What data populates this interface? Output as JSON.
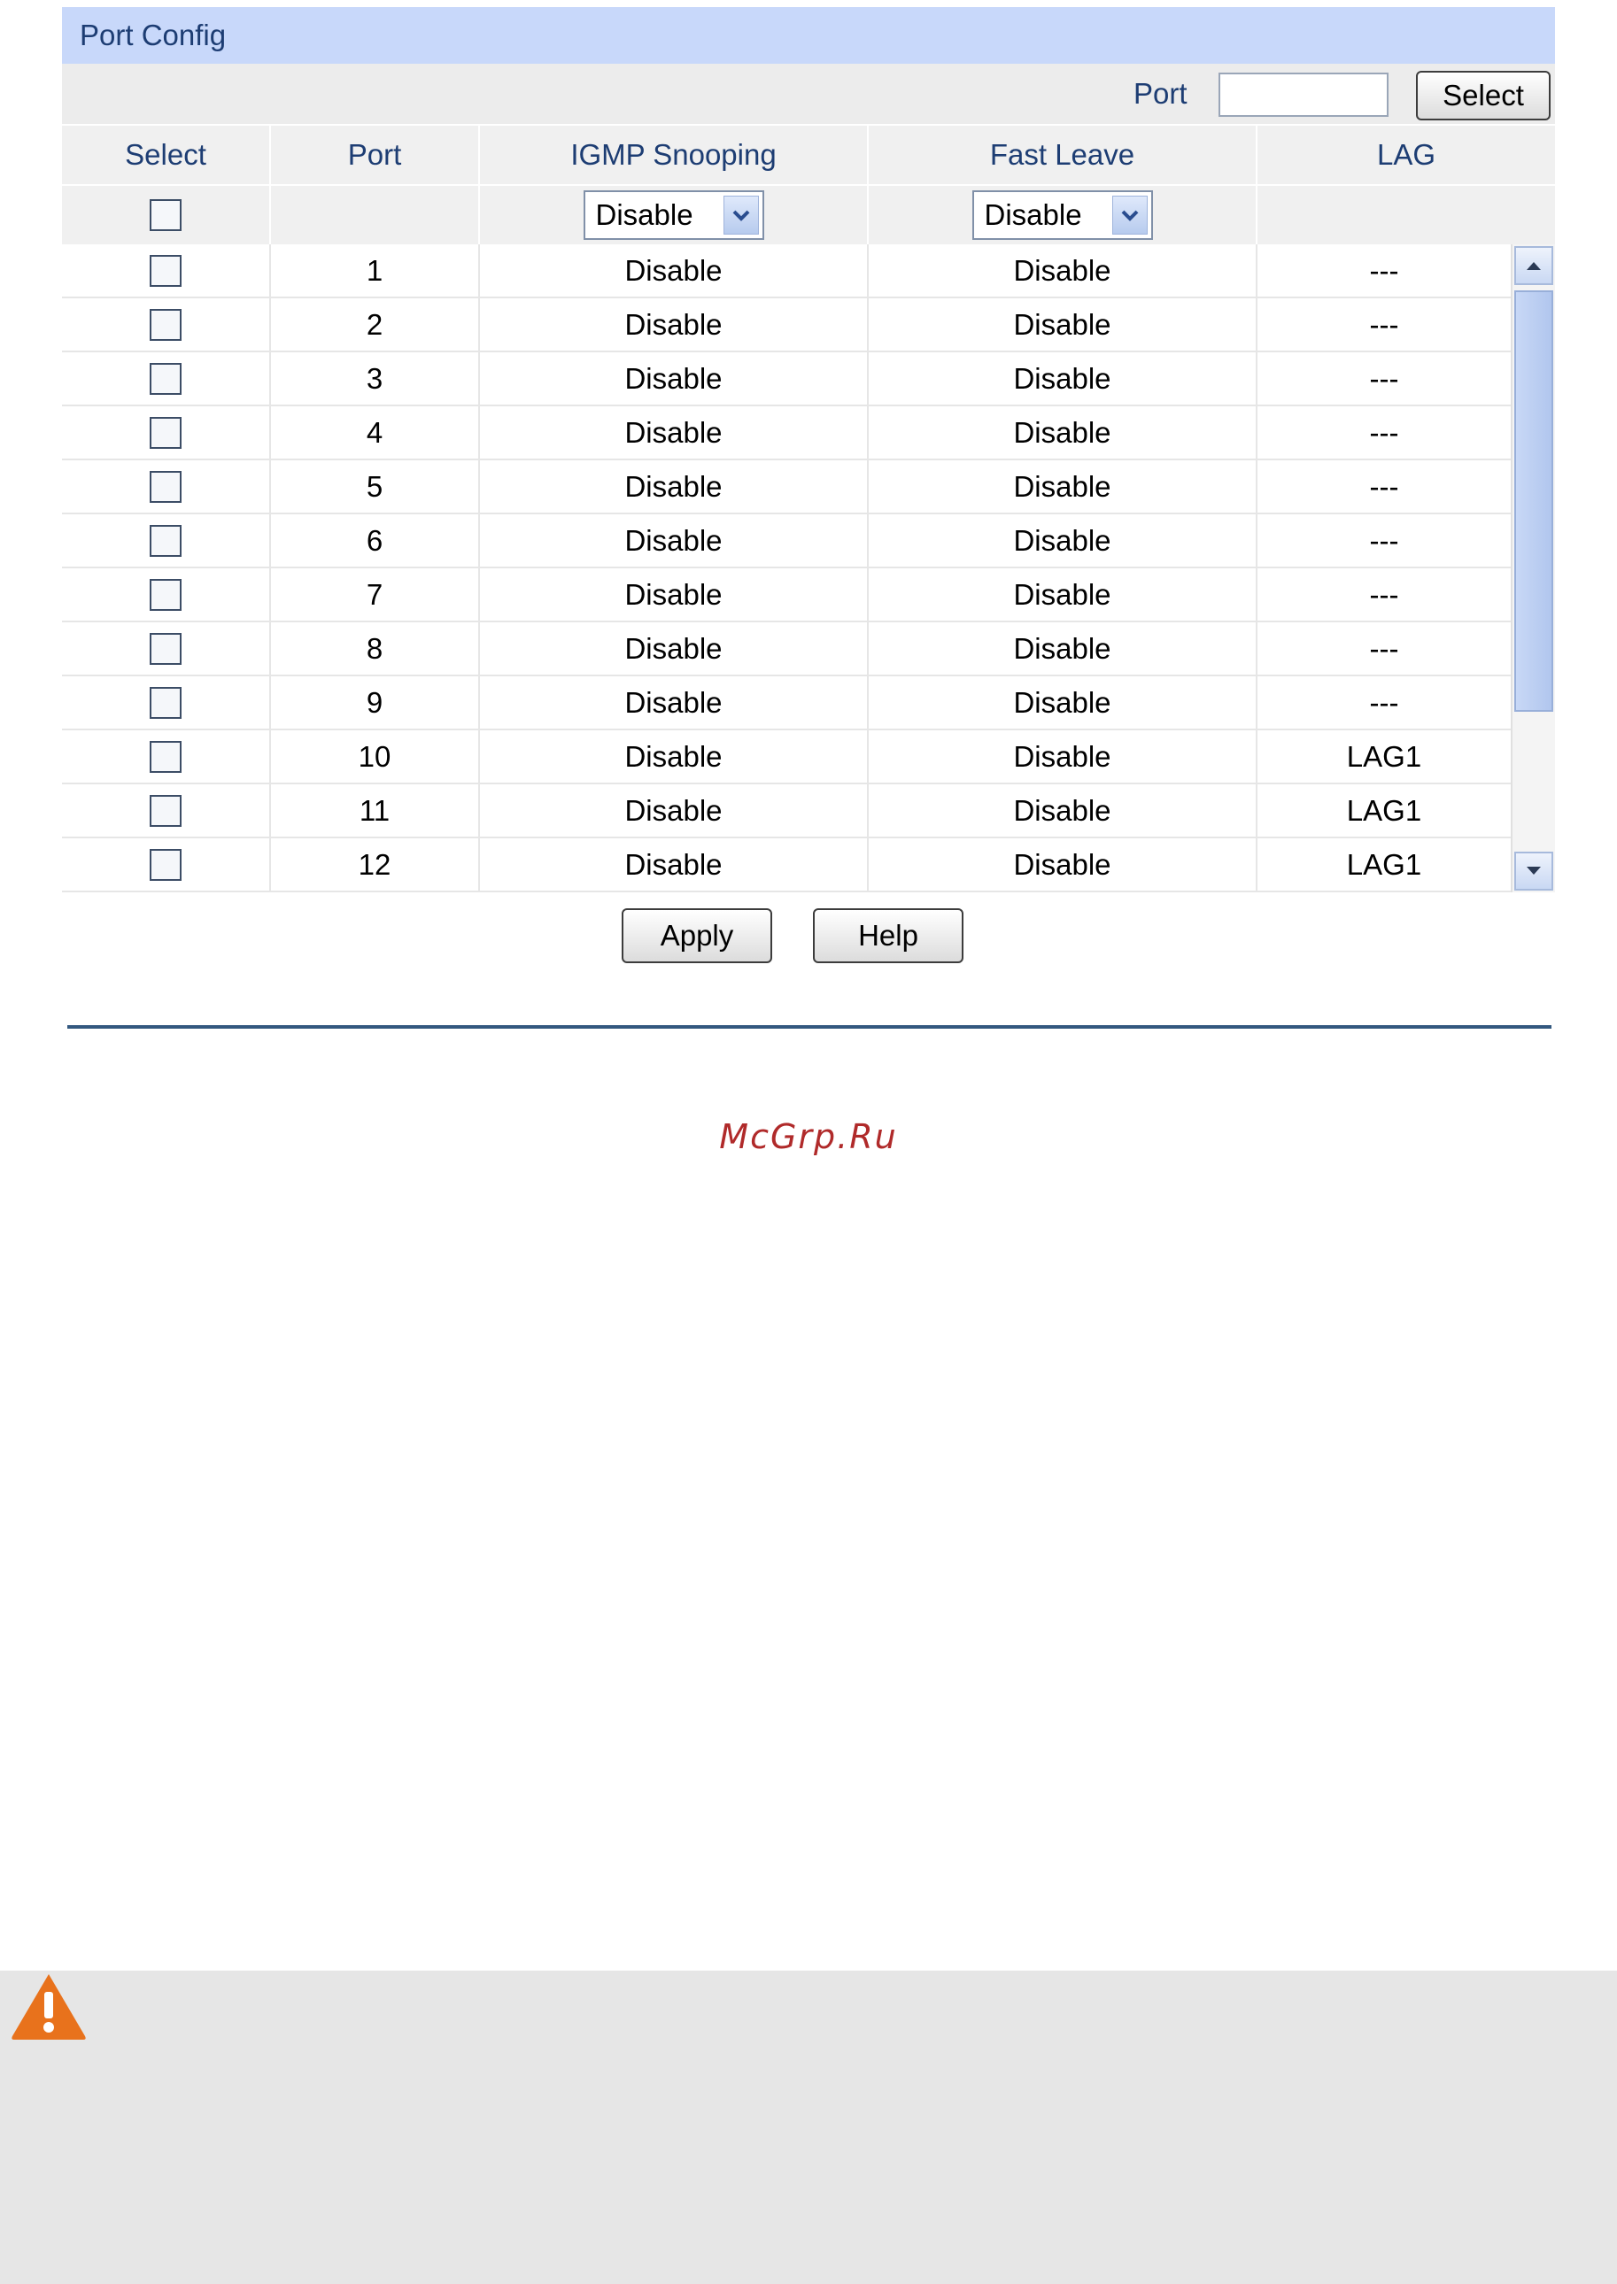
{
  "panel": {
    "title": "Port Config"
  },
  "filter": {
    "port_label": "Port",
    "port_value": "",
    "select_button": "Select"
  },
  "table": {
    "headers": [
      "Select",
      "Port",
      "IGMP Snooping",
      "Fast Leave",
      "LAG"
    ],
    "bulk": {
      "igmp": "Disable",
      "fast_leave": "Disable"
    },
    "rows": [
      {
        "port": "1",
        "igmp": "Disable",
        "fast_leave": "Disable",
        "lag": "---"
      },
      {
        "port": "2",
        "igmp": "Disable",
        "fast_leave": "Disable",
        "lag": "---"
      },
      {
        "port": "3",
        "igmp": "Disable",
        "fast_leave": "Disable",
        "lag": "---"
      },
      {
        "port": "4",
        "igmp": "Disable",
        "fast_leave": "Disable",
        "lag": "---"
      },
      {
        "port": "5",
        "igmp": "Disable",
        "fast_leave": "Disable",
        "lag": "---"
      },
      {
        "port": "6",
        "igmp": "Disable",
        "fast_leave": "Disable",
        "lag": "---"
      },
      {
        "port": "7",
        "igmp": "Disable",
        "fast_leave": "Disable",
        "lag": "---"
      },
      {
        "port": "8",
        "igmp": "Disable",
        "fast_leave": "Disable",
        "lag": "---"
      },
      {
        "port": "9",
        "igmp": "Disable",
        "fast_leave": "Disable",
        "lag": "---"
      },
      {
        "port": "10",
        "igmp": "Disable",
        "fast_leave": "Disable",
        "lag": "LAG1"
      },
      {
        "port": "11",
        "igmp": "Disable",
        "fast_leave": "Disable",
        "lag": "LAG1"
      },
      {
        "port": "12",
        "igmp": "Disable",
        "fast_leave": "Disable",
        "lag": "LAG1"
      }
    ]
  },
  "actions": {
    "apply": "Apply",
    "help": "Help"
  },
  "watermark": "McGrp.Ru",
  "colors": {
    "title_bar": "#c8d8fa",
    "divider": "#33587f",
    "watermark": "#b02a2a",
    "warning": "#e8721c"
  },
  "icons": {
    "warning": "warning-icon",
    "scroll_up": "arrow-up-icon",
    "scroll_down": "arrow-down-icon",
    "dropdown": "chevron-down-icon"
  }
}
